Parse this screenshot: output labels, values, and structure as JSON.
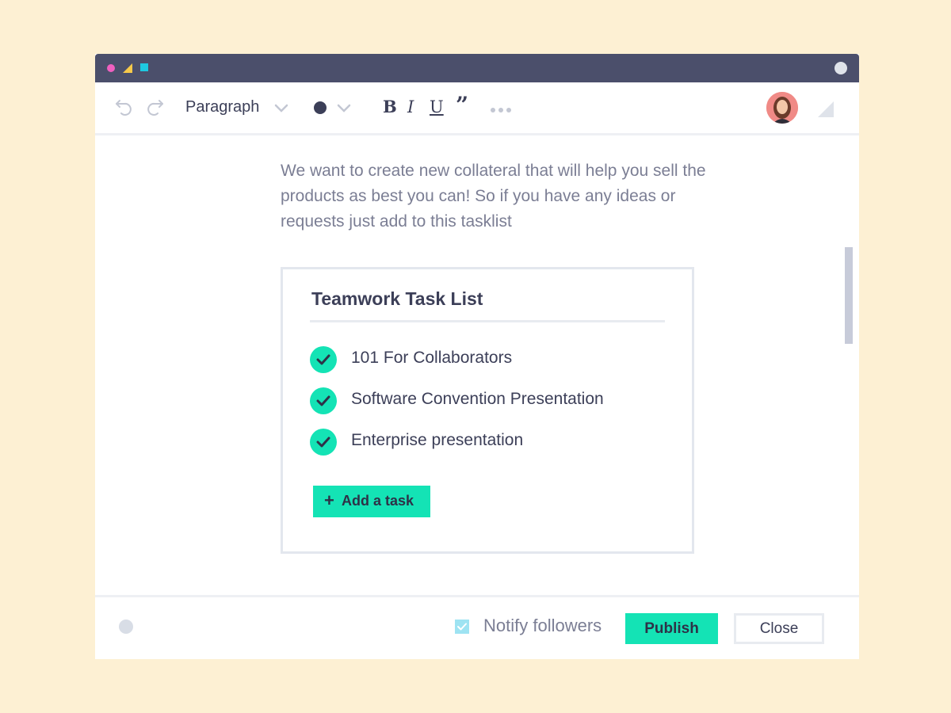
{
  "toolbar": {
    "block_format": "Paragraph",
    "bold": "B",
    "italic": "I",
    "underline": "U",
    "quote": "”",
    "text_color": "#3c3f58"
  },
  "editor": {
    "intro_text": "We want to create new collateral that will help you sell the products as best you can! So if you have any ideas or requests just add to this tasklist"
  },
  "tasklist": {
    "title": "Teamwork Task List",
    "tasks": [
      {
        "label": "101 For Collaborators",
        "completed": true
      },
      {
        "label": "Software Convention Presentation",
        "completed": true
      },
      {
        "label": "Enterprise presentation",
        "completed": true
      }
    ],
    "add_label": "Add a task"
  },
  "footer": {
    "notify_label": "Notify followers",
    "notify_checked": true,
    "publish_label": "Publish",
    "close_label": "Close"
  },
  "colors": {
    "accent": "#14e3b5",
    "titlebar": "#4b4f6b",
    "background": "#fdf0d3"
  }
}
